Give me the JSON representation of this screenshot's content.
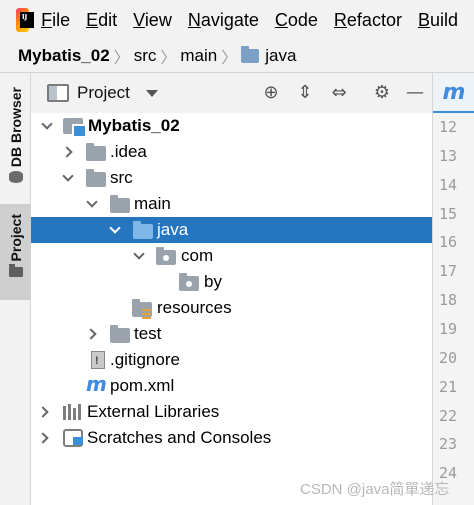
{
  "menubar": {
    "logo_text": "IJ",
    "items": [
      {
        "label": "File",
        "mnemonic": "F",
        "rest": "ile"
      },
      {
        "label": "Edit",
        "mnemonic": "E",
        "rest": "dit"
      },
      {
        "label": "View",
        "mnemonic": "V",
        "rest": "iew"
      },
      {
        "label": "Navigate",
        "mnemonic": "N",
        "rest": "avigate"
      },
      {
        "label": "Code",
        "mnemonic": "C",
        "rest": "ode"
      },
      {
        "label": "Refactor",
        "mnemonic": "R",
        "rest": "efactor"
      },
      {
        "label": "Build",
        "mnemonic": "B",
        "rest": "uild"
      }
    ]
  },
  "breadcrumb": {
    "items": [
      "Mybatis_02",
      "src",
      "main",
      "java"
    ]
  },
  "toolstrip": {
    "db_browser": "DB Browser",
    "project": "Project"
  },
  "panel": {
    "title": "Project",
    "icons": [
      "locate-icon",
      "expand-all-icon",
      "collapse-all-icon",
      "settings-icon",
      "hide-icon"
    ]
  },
  "tree": {
    "items": [
      {
        "label": "Mybatis_02",
        "icon": "module-icon",
        "chevron": "down",
        "bold": true
      },
      {
        "label": ".idea",
        "icon": "folder-icon",
        "chevron": "right"
      },
      {
        "label": "src",
        "icon": "folder-icon",
        "chevron": "down"
      },
      {
        "label": "main",
        "icon": "folder-icon",
        "chevron": "down"
      },
      {
        "label": "java",
        "icon": "source-folder-icon",
        "chevron": "down",
        "selected": true
      },
      {
        "label": "com",
        "icon": "package-icon",
        "chevron": "down"
      },
      {
        "label": "by",
        "icon": "package-icon",
        "chevron": ""
      },
      {
        "label": "resources",
        "icon": "resources-folder-icon",
        "chevron": ""
      },
      {
        "label": "test",
        "icon": "folder-icon",
        "chevron": "right"
      },
      {
        "label": ".gitignore",
        "icon": "gitignore-file-icon",
        "chevron": ""
      },
      {
        "label": "pom.xml",
        "icon": "maven-icon",
        "chevron": ""
      },
      {
        "label": "External Libraries",
        "icon": "libraries-icon",
        "chevron": "right"
      },
      {
        "label": "Scratches and Consoles",
        "icon": "scratches-icon",
        "chevron": "right"
      }
    ]
  },
  "editor": {
    "tab_icon_text": "m",
    "line_numbers": [
      "12",
      "13",
      "14",
      "15",
      "16",
      "17",
      "18",
      "19",
      "20",
      "21",
      "22",
      "23",
      "24"
    ]
  },
  "watermark": "CSDN @java简單递忘"
}
